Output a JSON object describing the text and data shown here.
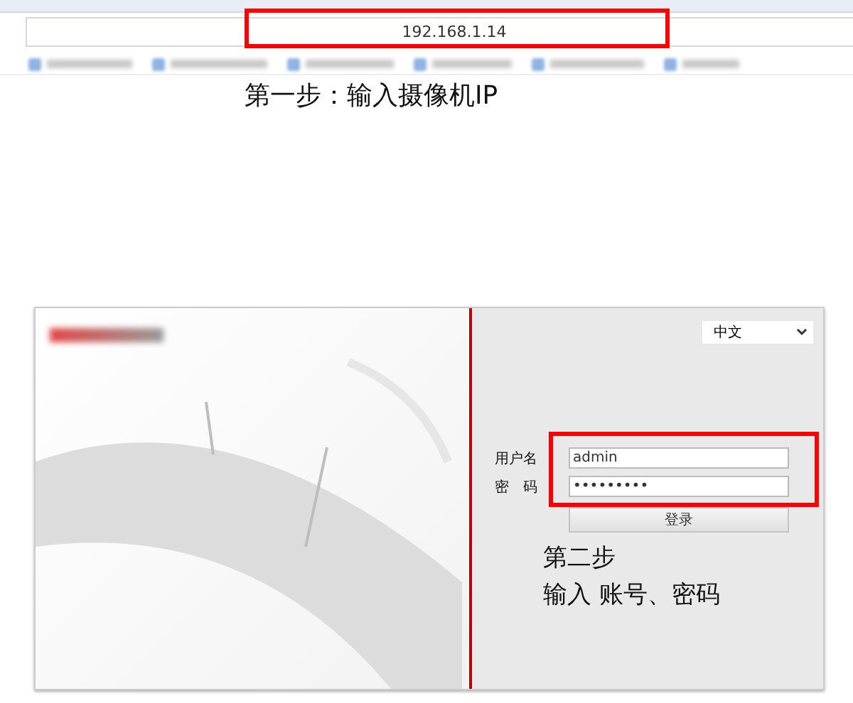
{
  "browser": {
    "address": "192.168.1.14"
  },
  "annotations": {
    "step_one": "第一步：输入摄像机IP",
    "step_two_title": "第二步",
    "step_two_text": "输入 账号、密码"
  },
  "login": {
    "language": "中文",
    "fields": [
      {
        "label": "用户名",
        "value": "admin"
      },
      {
        "label": "密　码",
        "value": "•••••••••"
      }
    ],
    "button": "登录"
  }
}
